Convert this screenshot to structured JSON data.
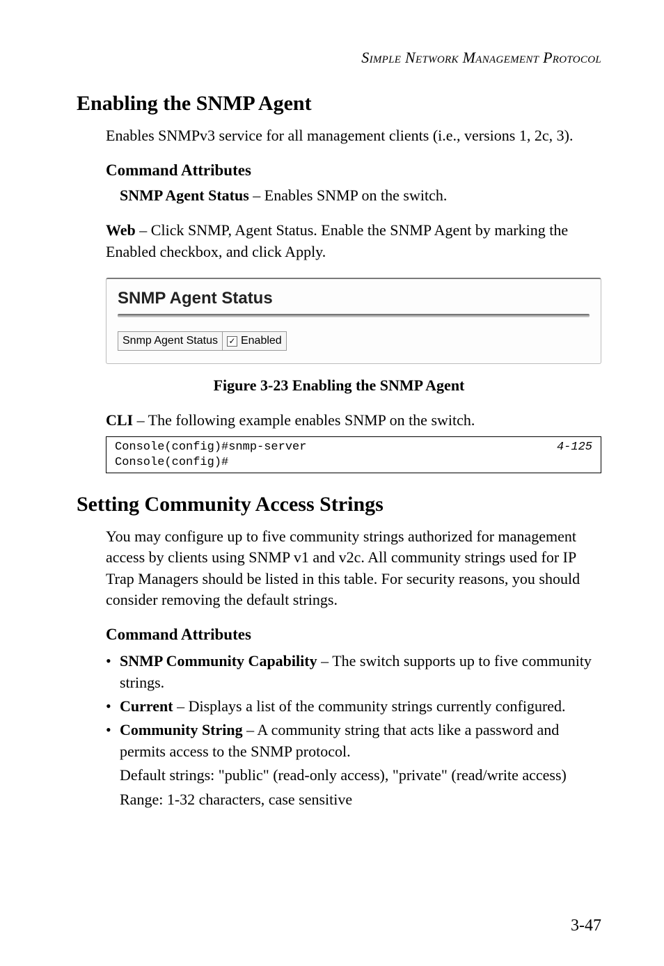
{
  "runningHeader": "Simple Network Management Protocol",
  "section1": {
    "title": "Enabling the SNMP Agent",
    "intro": "Enables SNMPv3 service for all management clients (i.e., versions 1, 2c, 3).",
    "cmdAttrHeading": "Command Attributes",
    "attrBold": "SNMP Agent Status",
    "attrRest": " – Enables SNMP on the switch.",
    "webBold": "Web",
    "webRest": " – Click SNMP, Agent Status. Enable the SNMP Agent by marking the Enabled checkbox, and click Apply.",
    "figure": {
      "panelTitle": "SNMP Agent Status",
      "rowLabel": "Snmp Agent Status",
      "checkboxChecked": true,
      "checkboxLabel": "Enabled",
      "caption": "Figure 3-23  Enabling the SNMP Agent"
    },
    "cliBold": "CLI",
    "cliRest": " – The following example enables SNMP on the switch.",
    "code": {
      "lines": "Console(config)#snmp-server\nConsole(config)#",
      "pageRef": "4-125"
    }
  },
  "section2": {
    "title": "Setting Community Access Strings",
    "intro": "You may configure up to five community strings authorized for management access by clients using SNMP v1 and v2c. All community strings used for IP Trap Managers should be listed in this table. For security reasons, you should consider removing the default strings.",
    "cmdAttrHeading": "Command Attributes",
    "bullets": [
      {
        "bold": "SNMP Community Capability",
        "rest": " – The switch supports up to five community strings."
      },
      {
        "bold": "Current",
        "rest": " – Displays a list of the community strings currently configured."
      },
      {
        "bold": "Community String",
        "rest": " – A community string that acts like a password and permits access to the SNMP protocol."
      }
    ],
    "subLines": [
      "Default strings: \"public\" (read-only access), \"private\" (read/write access)",
      "Range: 1-32 characters, case sensitive"
    ]
  },
  "pageNumber": "3-47"
}
